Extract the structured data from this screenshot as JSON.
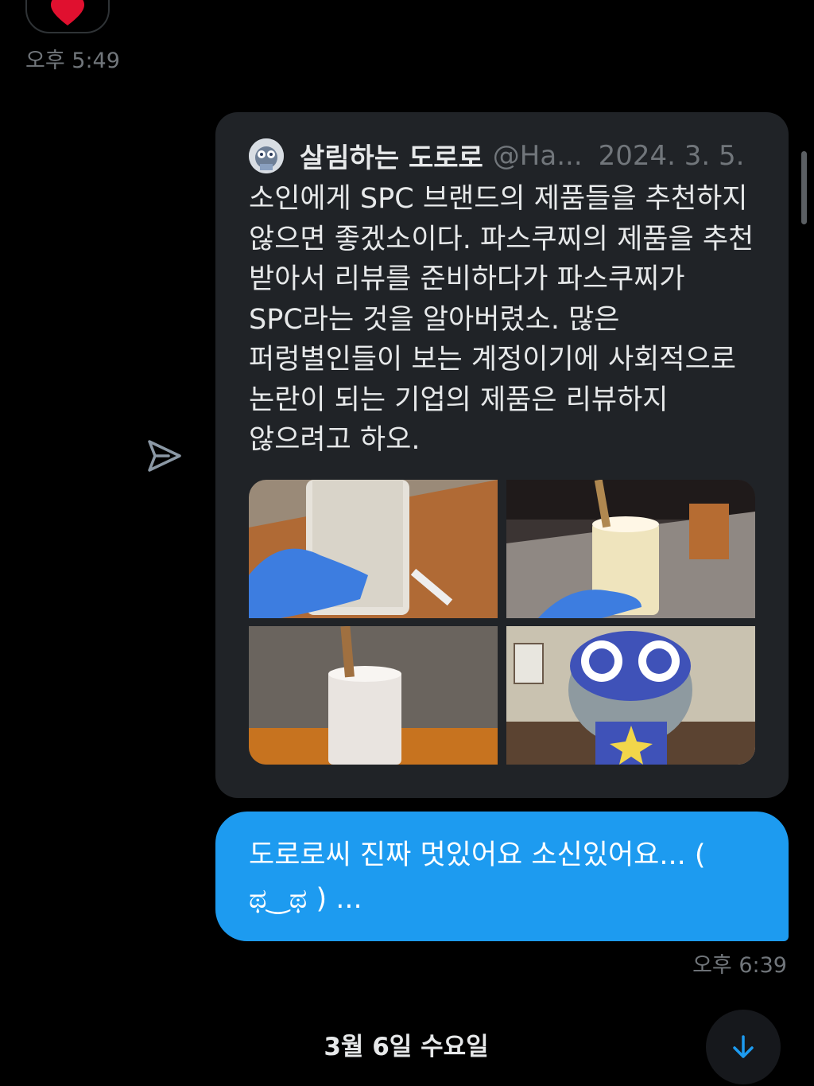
{
  "top_message": {
    "reaction": "heart",
    "time": "오후 5:49"
  },
  "quoted_tweet": {
    "author_name": "살림하는 도로로",
    "author_handle": "@Ha...",
    "date": "2024. 3. 5.",
    "text": "소인에게 SPC 브랜드의 제품들을 추천하지 않으면 좋겠소이다. 파스쿠찌의 제품을 추천 받아서 리뷰를 준비하다가 파스쿠찌가 SPC라는 것을 알아버렸소. 많은 퍼렁별인들이 보는 계정이기에 사회적으로 논란이 되는 기업의 제품은 리뷰하지 않으려고 하오.",
    "media_count": 4
  },
  "sent_message": {
    "text": "도로로씨 진짜 멋있어요 소신있어요... ( ಥ‿ಥ ) ...",
    "time": "오후 6:39"
  },
  "date_separator": "3월 6일 수요일",
  "icons": {
    "reaction": "heart-icon",
    "share": "share-icon",
    "scroll": "arrow-down-icon"
  },
  "colors": {
    "background": "#000000",
    "card": "#202327",
    "bubble": "#1d9bf0",
    "muted_text": "#71767b",
    "heart": "#f91880"
  }
}
